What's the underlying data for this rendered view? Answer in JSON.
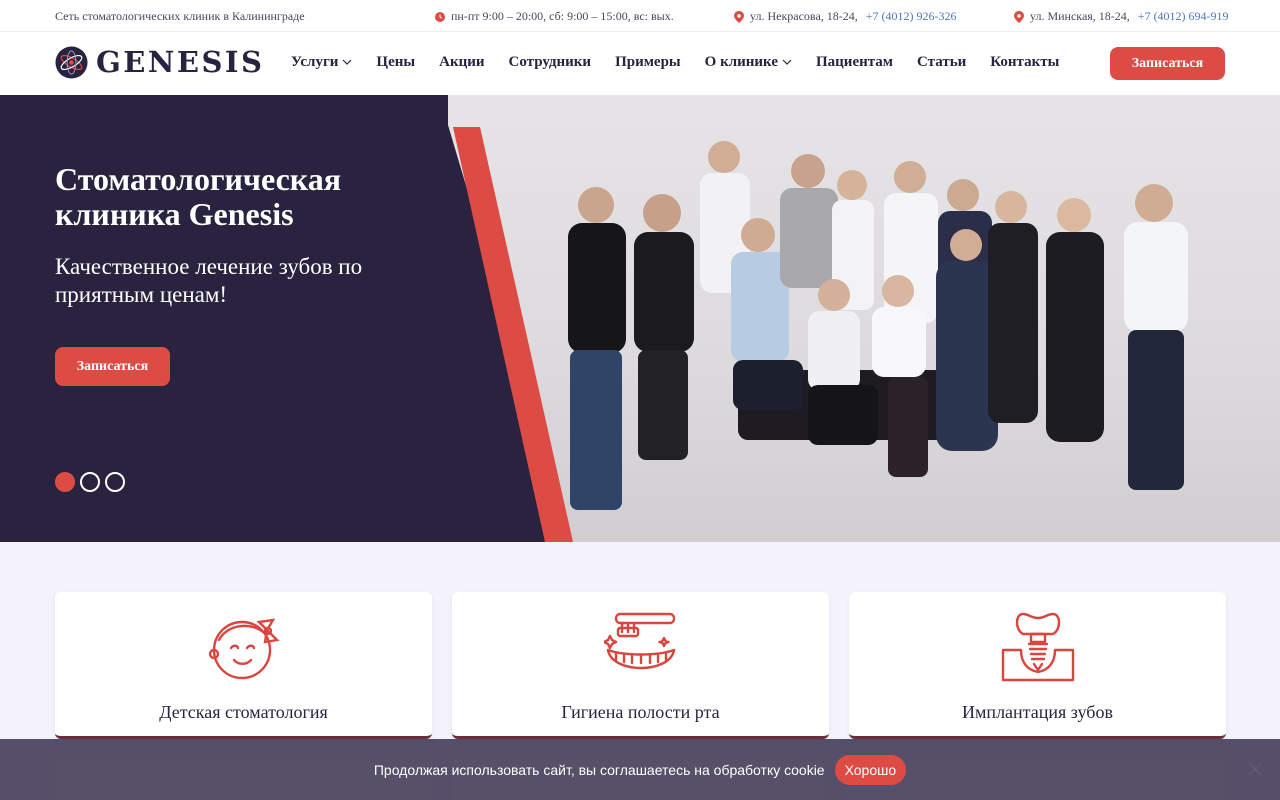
{
  "topbar": {
    "tagline": "Сеть стоматологических клиник в Калининграде",
    "hours": "пн-пт 9:00 – 20:00, сб: 9:00 – 15:00, вс: вых.",
    "address1": "ул. Некрасова, 18-24,",
    "phone1": "+7 (4012) 926-326",
    "address2": "ул. Минская, 18-24,",
    "phone2": "+7 (4012) 694-919",
    "icons": [
      "clock-icon",
      "location-pin-icon"
    ]
  },
  "header": {
    "logo_text": "GENESIS",
    "nav": [
      {
        "label": "Услуги",
        "dropdown": true
      },
      {
        "label": "Цены",
        "dropdown": false
      },
      {
        "label": "Акции",
        "dropdown": false
      },
      {
        "label": "Сотрудники",
        "dropdown": false
      },
      {
        "label": "Примеры",
        "dropdown": false
      },
      {
        "label": "О клинике",
        "dropdown": true
      },
      {
        "label": "Пациентам",
        "dropdown": false
      },
      {
        "label": "Статьи",
        "dropdown": false
      },
      {
        "label": "Контакты",
        "dropdown": false
      }
    ],
    "cta": "Записаться"
  },
  "hero": {
    "title": "Стоматологическая клиника Genesis",
    "subtitle": "Качественное лечение зубов по приятным ценам!",
    "cta": "Записаться",
    "slides": 3,
    "active_slide": 1
  },
  "services": [
    {
      "title": "Детская стоматология",
      "icon": "child-face-icon"
    },
    {
      "title": "Гигиена полости рта",
      "icon": "toothbrush-teeth-icon"
    },
    {
      "title": "Имплантация зубов",
      "icon": "dental-implant-icon"
    }
  ],
  "cookie": {
    "text": "Продолжая использовать сайт, вы соглашаетесь на обработку cookie",
    "ok": "Хорошо"
  },
  "colors": {
    "accent": "#dd4b45",
    "dark": "#2a2340",
    "link": "#4f78b6",
    "page_bg": "#f4f3fb"
  }
}
